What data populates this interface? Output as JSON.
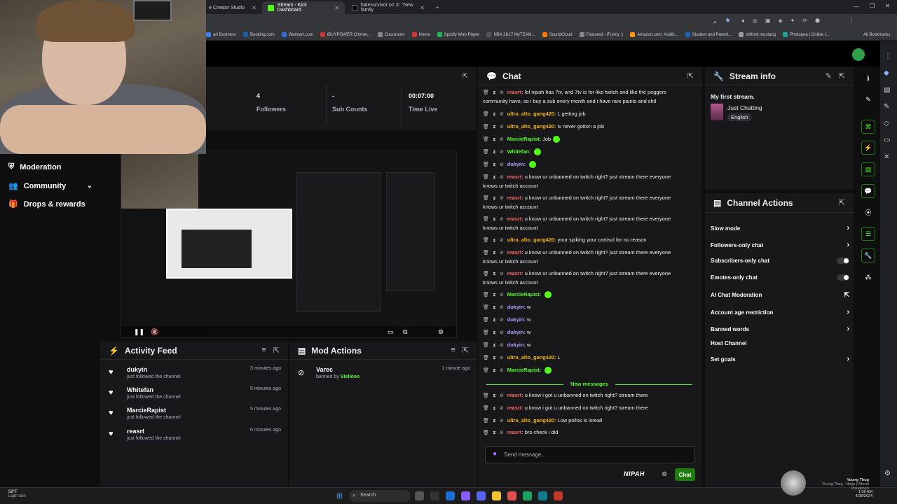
{
  "browser": {
    "tabs": [
      {
        "label": "e Creator Studio",
        "color": "#ff0000"
      },
      {
        "label": "Stream - Kick Dashboard",
        "color": "#53fc18"
      },
      {
        "label": "hatesurvivor on X: \"New family",
        "color": "#000000"
      }
    ],
    "bookmarks": [
      "art Business",
      "Booking.com",
      "Walmart.com",
      "iBUYPOWER Chimer...",
      "Classroom",
      "Home",
      "Spotify Web Player",
      "NBA 2K17 MyTEAM...",
      "SoundCloud",
      "Featured - iFunny :)",
      "Amazon.com: Audib...",
      "Student and Parent...",
      "milford mustang",
      "Photopea | Online I..."
    ],
    "all_bookmarks": "All Bookmarks"
  },
  "sidebar": {
    "items": [
      {
        "label": "Moderation",
        "icon": "shield-icon"
      },
      {
        "label": "Community",
        "icon": "people-icon"
      },
      {
        "label": "Drops & rewards",
        "icon": "gift-icon"
      }
    ]
  },
  "stats": [
    {
      "value": "4",
      "label": "Followers"
    },
    {
      "value": "-",
      "label": "Sub Counts"
    },
    {
      "value": "00:07:00",
      "label": "Time Live"
    }
  ],
  "activity": {
    "title": "Activity Feed",
    "items": [
      {
        "name": "dukyin",
        "action": "just followed the channel",
        "time": "3 minutes ago"
      },
      {
        "name": "Whitefan",
        "action": "just followed the channel",
        "time": "5 minutes ago"
      },
      {
        "name": "MarcieRapist",
        "action": "just followed the channel",
        "time": "5 minutes ago"
      },
      {
        "name": "reasrt",
        "action": "just followed the channel",
        "time": "6 minutes ago"
      }
    ]
  },
  "mod_actions": {
    "title": "Mod Actions",
    "items": [
      {
        "name": "Varec",
        "action": "banned by",
        "by": "Stellooo",
        "time": "1 minute ago"
      }
    ]
  },
  "chat": {
    "title": "Chat",
    "messages": [
      {
        "user": "reasrt:",
        "text": "lol nipah has 7tv, and 7tv is for like twitch and like the poggers community have, so i buy a sub every month and i have rare paints and shtl",
        "color": "#ff6b6b"
      },
      {
        "user": "ultra_alto_gang420:",
        "text": "L getting job",
        "color": "#f0b400"
      },
      {
        "user": "ultra_alto_gang420:",
        "text": "iv never gotton a job",
        "color": "#f0b400"
      },
      {
        "user": "MarcieRapist:",
        "text": "Job",
        "color": "#53fc18"
      },
      {
        "user": "Whitefan:",
        "text": "",
        "color": "#53fc18"
      },
      {
        "user": "dukyin:",
        "text": "",
        "color": "#b69cff"
      },
      {
        "user": "reasrt:",
        "text": "u know ur unbanned on twitch right? just stream there everyone knows ur twitch account",
        "color": "#ff6b6b"
      },
      {
        "user": "reasrt:",
        "text": "u know ur unbanned on twitch right? just stream there everyone knows ur twitch account",
        "color": "#ff6b6b"
      },
      {
        "user": "reasrt:",
        "text": "u know ur unbanned on twitch right? just stream there everyone knows ur twitch account",
        "color": "#ff6b6b"
      },
      {
        "user": "ultra_alto_gang420:",
        "text": "your spiking your cortisol for no reason",
        "color": "#f0b400"
      },
      {
        "user": "reasrt:",
        "text": "u know ur unbanned on twitch right? just stream there everyone knows ur twitch account",
        "color": "#ff6b6b"
      },
      {
        "user": "reasrt:",
        "text": "u know ur unbanned on twitch right? just stream there everyone knows ur twitch account",
        "color": "#ff6b6b"
      },
      {
        "user": "MarcieRapist:",
        "text": "",
        "color": "#53fc18"
      },
      {
        "user": "dukyin:",
        "text": "w",
        "color": "#b69cff"
      },
      {
        "user": "dukyin:",
        "text": "w",
        "color": "#b69cff"
      },
      {
        "user": "dukyin:",
        "text": "w",
        "color": "#b69cff"
      },
      {
        "user": "dukyin:",
        "text": "w",
        "color": "#b69cff"
      },
      {
        "user": "ultra_alto_gang420:",
        "text": "L",
        "color": "#f0b400"
      },
      {
        "user": "MarcieRapist:",
        "text": "",
        "color": "#53fc18"
      },
      {
        "user": "reasrt:",
        "text": "u know i got u unbanned on twitch right? stream there",
        "color": "#ff6b6b"
      },
      {
        "user": "reasrt:",
        "text": "u know i got u unbanned on twitch right? stream there",
        "color": "#ff6b6b"
      },
      {
        "user": "ultra_alto_gang420:",
        "text": "Low pollos is isreali",
        "color": "#f0b400"
      },
      {
        "user": "reasrt:",
        "text": "bro check i did",
        "color": "#ff6b6b"
      }
    ],
    "new_messages": "New messages",
    "input_placeholder": "Send message...",
    "send_label": "Chat",
    "nipah": "NIPAH"
  },
  "stream_info": {
    "title": "Stream info",
    "stream_title": "My first stream.",
    "category": "Just Chatting",
    "language": "English"
  },
  "channel_actions": {
    "title": "Channel Actions",
    "items": [
      {
        "label": "Slow mode",
        "control": "chevron"
      },
      {
        "label": "Followers-only chat",
        "control": "chevron"
      },
      {
        "label": "Subscribers-only chat",
        "control": "toggle"
      },
      {
        "label": "Emotes-only chat",
        "control": "toggle"
      },
      {
        "label": "AI Chat Moderation",
        "control": "external"
      },
      {
        "label": "Account age restriction",
        "control": "chevron"
      },
      {
        "label": "Banned words",
        "control": "chevron"
      },
      {
        "label": "Host Channel",
        "control": "none"
      },
      {
        "label": "Set goals",
        "control": "chevron"
      }
    ]
  },
  "taskbar": {
    "weather_temp": "58°F",
    "weather_desc": "Light rain",
    "search": "Search",
    "now_playing_title": "Young Thug",
    "now_playing_sub": "Young Thug - Ninja (Official Visualizer)",
    "time": "1:08 AM",
    "date": "4/28/2024"
  },
  "colors": {
    "accent": "#53fc18",
    "panel": "#18181b",
    "bg": "#0f0f0f"
  }
}
